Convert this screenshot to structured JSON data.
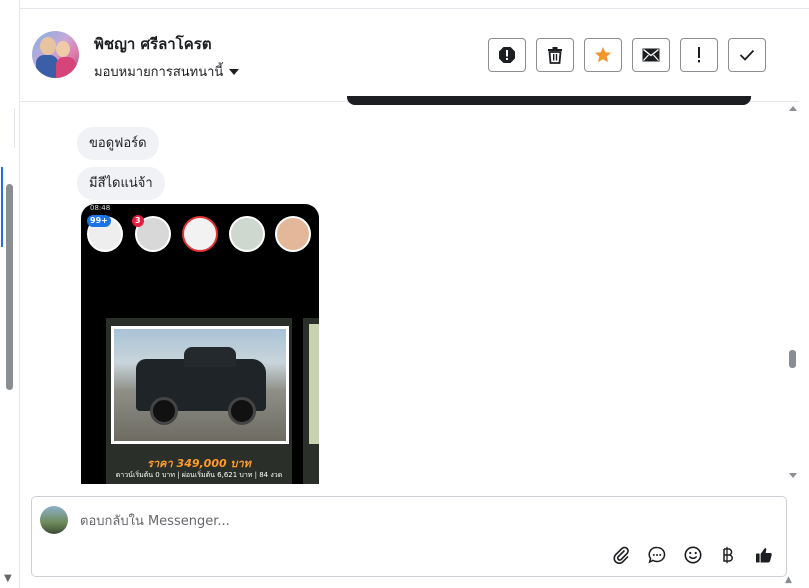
{
  "contact": {
    "name": "พิชญา ศรีลาโครต",
    "assign_label": "มอบหมายการสนทนานี้"
  },
  "toolbar": {
    "buttons": [
      {
        "icon": "alert-circle-icon"
      },
      {
        "icon": "trash-icon"
      },
      {
        "icon": "star-icon",
        "color": "#f5962b"
      },
      {
        "icon": "mail-icon"
      },
      {
        "icon": "exclamation-icon"
      },
      {
        "icon": "checkmark-icon"
      }
    ]
  },
  "messages": [
    {
      "text": "ขอดูฟอร์ด"
    },
    {
      "text": "มีสีไดแน่จ้า"
    }
  ],
  "shared_image": {
    "status_time": "08:48",
    "badges": [
      "99+",
      "3"
    ],
    "price_text": "ราคา 349,000 บาท",
    "terms_text": "ดาวน์เริ่มต้น 0 บาท | ผ่อนเริ่มต้น 6,621 บาท | 84 งวด"
  },
  "composer": {
    "placeholder": "ตอบกลับใน Messenger...",
    "icons": [
      "paperclip-icon",
      "chat-bubble-icon",
      "emoji-icon",
      "baht-icon",
      "thumbs-up-icon"
    ]
  },
  "colors": {
    "star": "#f5962b",
    "accent": "#1b74e4",
    "bubble": "#f0f2f5"
  }
}
